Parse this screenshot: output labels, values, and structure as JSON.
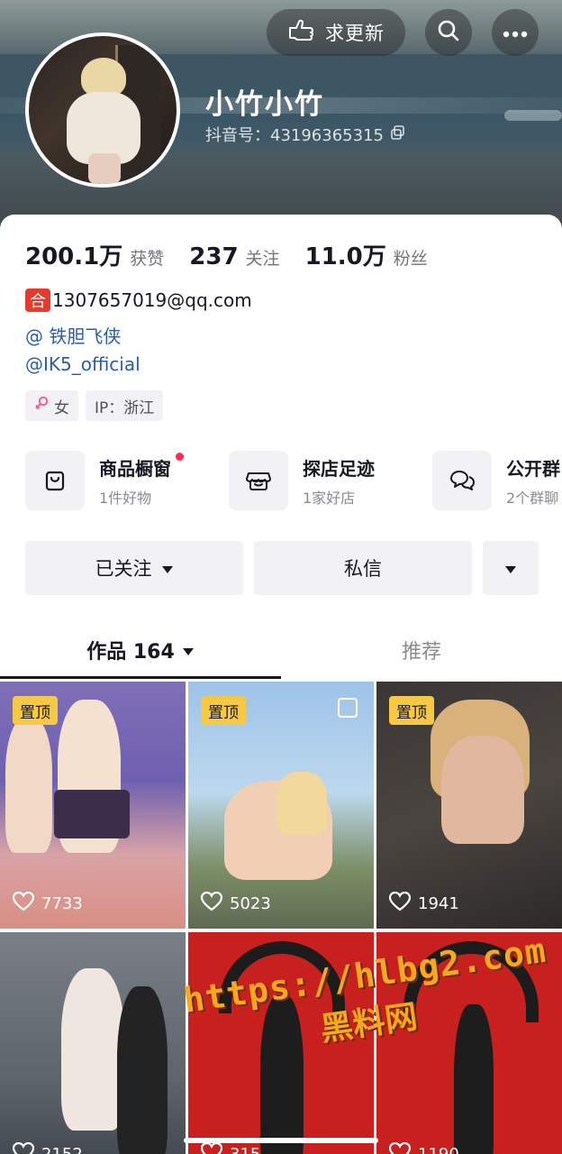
{
  "header": {
    "update_label": "求更新",
    "nickname": "小竹小竹",
    "douyin_id": "抖音号：43196365315"
  },
  "stats": [
    {
      "num": "200.1万",
      "label": "获赞"
    },
    {
      "num": "237",
      "label": "关注"
    },
    {
      "num": "11.0万",
      "label": "粉丝"
    }
  ],
  "bio": {
    "badge": "合",
    "line1": "1307657019@qq.com",
    "line2": "@ 铁胆飞侠",
    "line3": "@IK5_official"
  },
  "tags": {
    "gender": "女",
    "ip": "IP：浙江"
  },
  "entries": [
    {
      "title": "商品橱窗",
      "subtitle": "1件好物"
    },
    {
      "title": "探店足迹",
      "subtitle": "1家好店"
    },
    {
      "title": "公开群",
      "subtitle": "2个群聊"
    }
  ],
  "actions": {
    "follow": "已关注",
    "message": "私信"
  },
  "tabs": {
    "works": "作品 164",
    "recommend": "推荐"
  },
  "videos": [
    {
      "pinned": "置顶",
      "likes": "7733"
    },
    {
      "pinned": "置顶",
      "likes": "5023"
    },
    {
      "pinned": "置顶",
      "likes": "1941"
    },
    {
      "likes": "2152"
    },
    {
      "likes": "315"
    },
    {
      "likes": "1190"
    }
  ],
  "watermark": {
    "url": "https://hlbg2.com",
    "name": "黑料网"
  },
  "colors": {
    "accent_red": "#fe2c55",
    "link_blue": "#2b5ea8",
    "pin_yellow": "#f7c844",
    "watermark_orange": "#f7a81b"
  }
}
